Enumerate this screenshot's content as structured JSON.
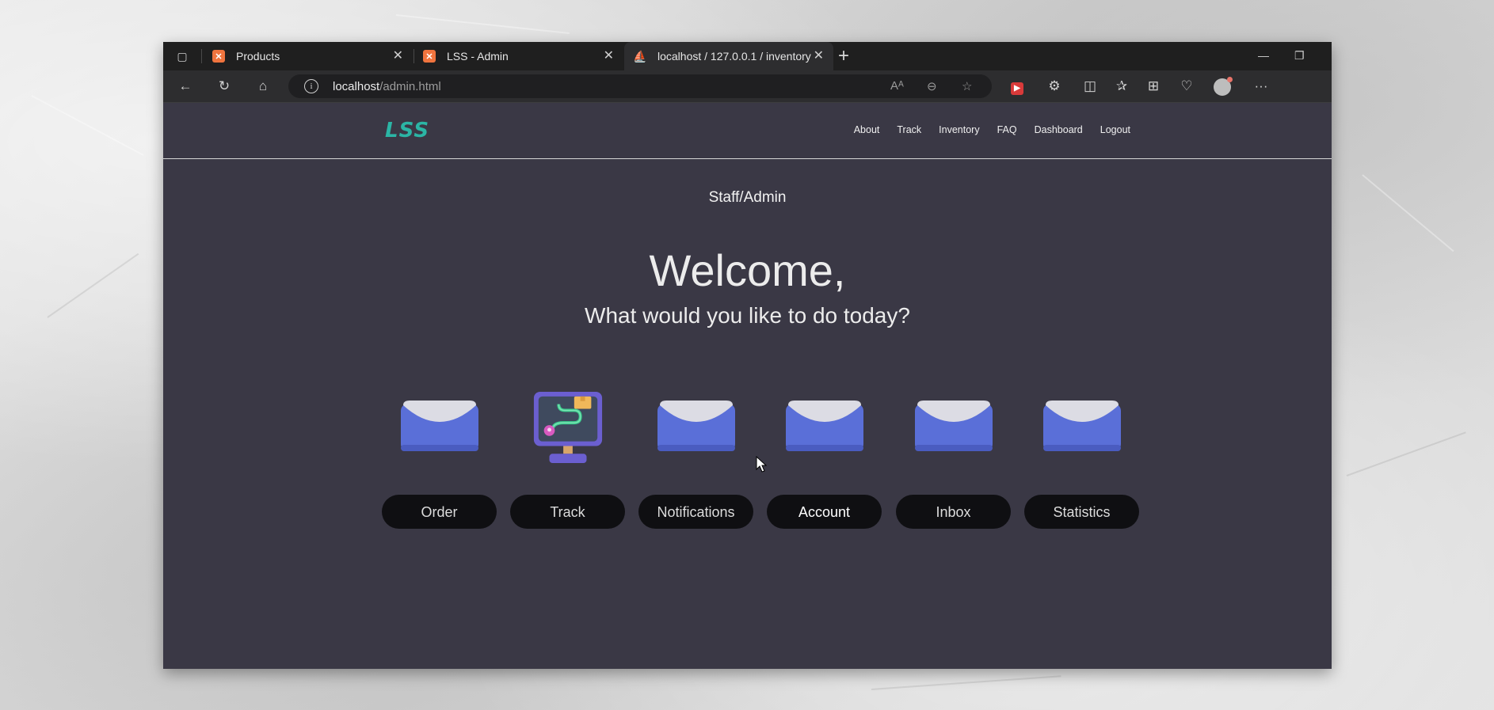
{
  "browser": {
    "tabs": [
      {
        "title": "Products",
        "favicon": "xampp-icon"
      },
      {
        "title": "LSS - Admin",
        "favicon": "xampp-icon"
      },
      {
        "title": "localhost / 127.0.0.1 / inventory /",
        "favicon": "phpmyadmin-icon"
      }
    ],
    "address": {
      "host": "localhost",
      "path": "/admin.html"
    }
  },
  "site": {
    "logo": "LSS",
    "nav": [
      "About",
      "Track",
      "Inventory",
      "FAQ",
      "Dashboard",
      "Logout"
    ]
  },
  "main": {
    "role": "Staff/Admin",
    "welcome": "Welcome,",
    "subtitle": "What would you like to do today?",
    "actions": [
      {
        "label": "Order",
        "icon": "envelope-icon"
      },
      {
        "label": "Track",
        "icon": "tracking-monitor-icon"
      },
      {
        "label": "Notifications",
        "icon": "envelope-icon"
      },
      {
        "label": "Account",
        "icon": "envelope-icon"
      },
      {
        "label": "Inbox",
        "icon": "envelope-icon"
      },
      {
        "label": "Statistics",
        "icon": "envelope-icon"
      }
    ]
  },
  "colors": {
    "page_bg": "#3a3845",
    "button_bg": "#0f0f12",
    "envelope_blue": "#5a6fd8",
    "logo": "#2bb5a5"
  }
}
